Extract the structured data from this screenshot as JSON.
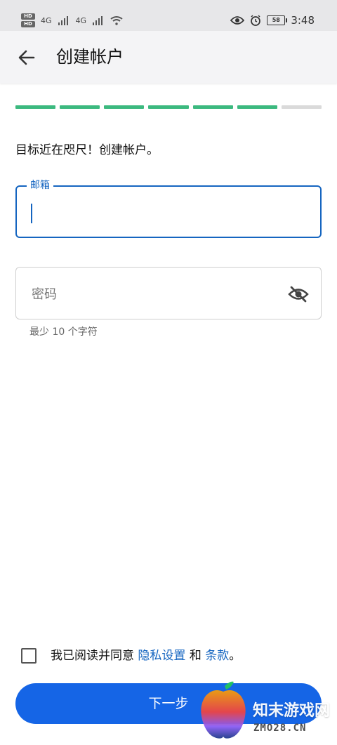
{
  "status_bar": {
    "hd_top": "HD",
    "hd_bottom": "HD",
    "network_1": "4G",
    "network_2": "4G",
    "battery": "58",
    "time": "3:48"
  },
  "app_bar": {
    "title": "创建帐户"
  },
  "progress": {
    "completed_steps": 6,
    "total_steps": 7,
    "done_color": "#3cb97f",
    "todo_color": "#dadada"
  },
  "subtitle": "目标近在咫尺！创建帐户。",
  "email": {
    "label": "邮箱",
    "value": ""
  },
  "password": {
    "placeholder": "密码",
    "helper": "最少 10 个字符"
  },
  "terms": {
    "prefix": "我已阅读并同意",
    "privacy_link": "隐私设置",
    "connector": "和",
    "terms_link": "条款",
    "suffix": "。"
  },
  "next_button": {
    "label": "下一步",
    "color": "#1565e6"
  },
  "watermark": {
    "title": "知末游戏网",
    "subtitle": "ZMO28.CN"
  }
}
